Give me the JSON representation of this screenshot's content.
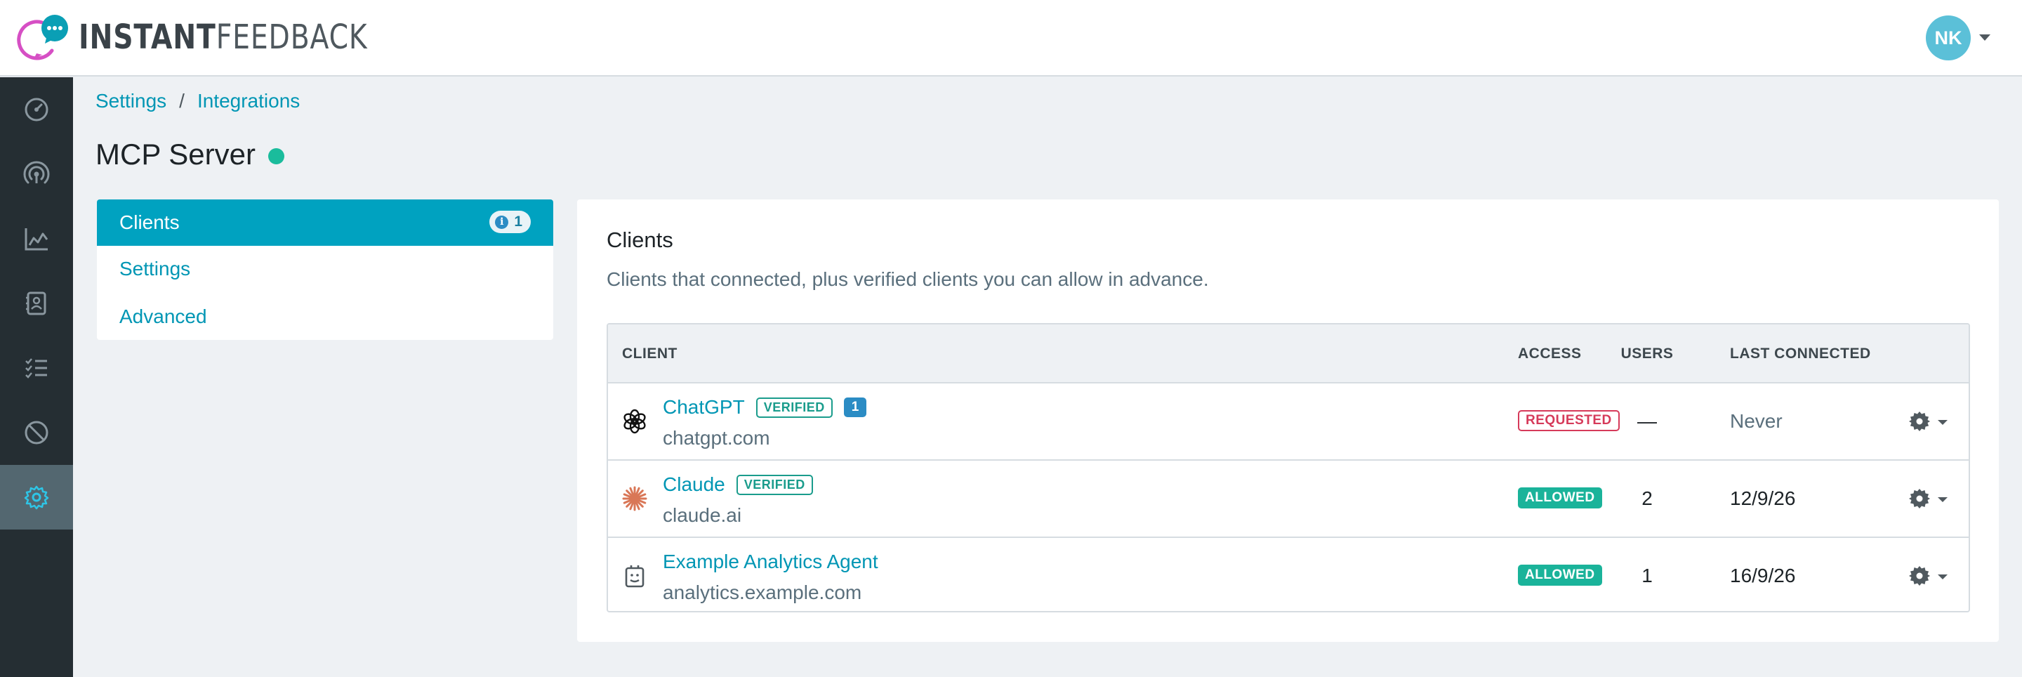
{
  "brand": {
    "name_bold": "INSTANT",
    "name_light": "FEEDBACK",
    "accent": "#0096b4",
    "logo_pink": "#d64fc4",
    "logo_teal": "#0a9fb5"
  },
  "user": {
    "initials": "NK"
  },
  "sidebar": {
    "items": [
      {
        "icon": "gauge-icon"
      },
      {
        "icon": "broadcast-icon"
      },
      {
        "icon": "line-chart-icon"
      },
      {
        "icon": "contact-book-icon"
      },
      {
        "icon": "checklist-icon"
      },
      {
        "icon": "block-icon"
      },
      {
        "icon": "gear-icon",
        "active": true
      }
    ]
  },
  "breadcrumb": {
    "items": [
      "Settings",
      "Integrations"
    ],
    "separator": "/"
  },
  "page": {
    "title": "MCP Server",
    "status_color": "#1abc9c"
  },
  "menu": {
    "items": [
      {
        "label": "Clients",
        "active": true,
        "count": "1"
      },
      {
        "label": "Settings"
      },
      {
        "label": "Advanced"
      }
    ]
  },
  "panel": {
    "title": "Clients",
    "description": "Clients that connected, plus verified clients you can allow in advance."
  },
  "table": {
    "headers": {
      "client": "CLIENT",
      "access": "ACCESS",
      "users": "USERS",
      "last_connected": "LAST CONNECTED"
    },
    "rows": [
      {
        "name": "ChatGPT",
        "verified": "VERIFIED",
        "count": "1",
        "domain": "chatgpt.com",
        "access": "REQUESTED",
        "users": "—",
        "last": "Never",
        "icon": "openai-icon"
      },
      {
        "name": "Claude",
        "verified": "VERIFIED",
        "domain": "claude.ai",
        "access": "ALLOWED",
        "users": "2",
        "last": "12/9/26",
        "icon": "claude-icon"
      },
      {
        "name": "Example Analytics Agent",
        "domain": "analytics.example.com",
        "access": "ALLOWED",
        "users": "1",
        "last": "16/9/26",
        "icon": "robot-icon"
      }
    ]
  }
}
